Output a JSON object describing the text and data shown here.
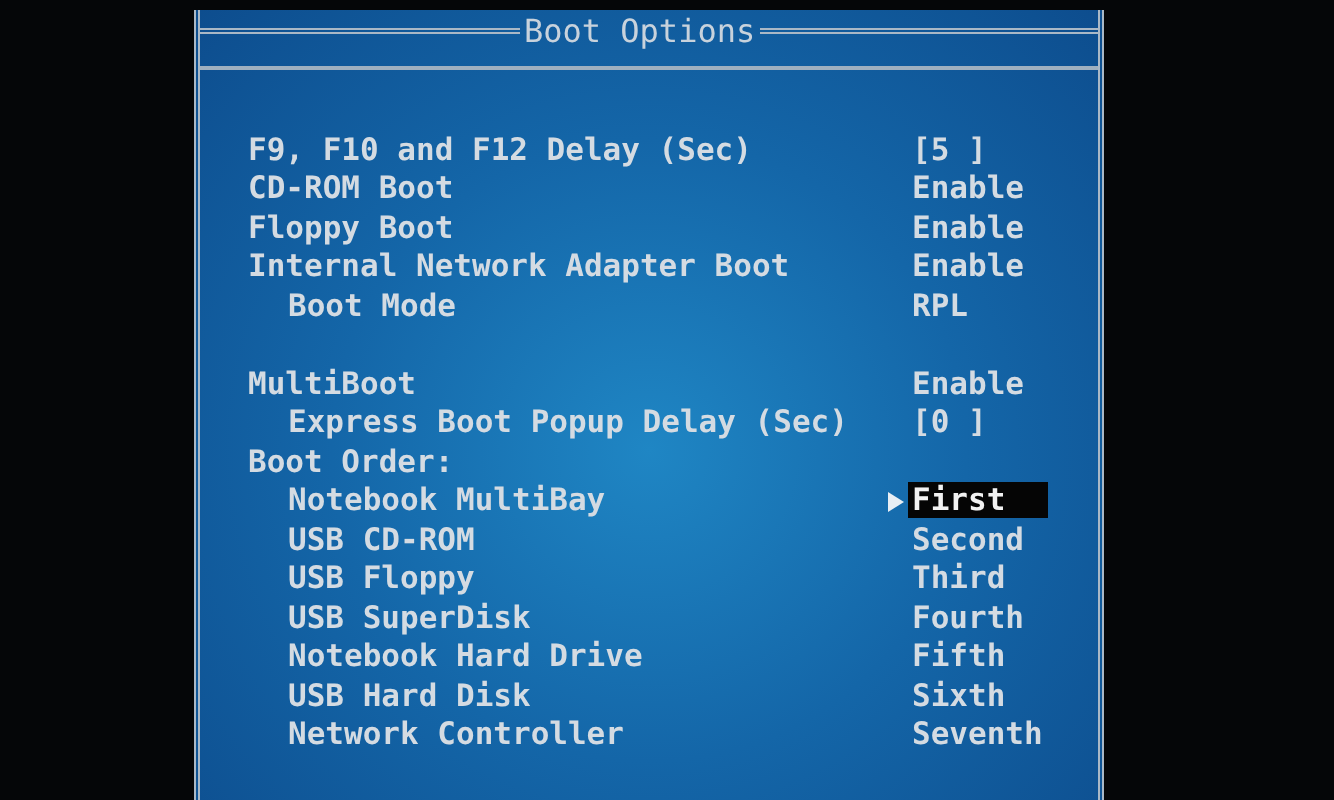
{
  "window": {
    "title": "Boot Options"
  },
  "groups": [
    {
      "items": [
        {
          "label": "F9, F10 and F12 Delay (Sec)",
          "value": "[5 ]"
        },
        {
          "label": "CD-ROM Boot",
          "value": "Enable"
        },
        {
          "label": "Floppy Boot",
          "value": "Enable"
        },
        {
          "label": "Internal Network Adapter Boot",
          "value": "Enable",
          "children": [
            {
              "label": "Boot Mode",
              "value": "RPL"
            }
          ]
        }
      ]
    },
    {
      "items": [
        {
          "label": "MultiBoot",
          "value": "Enable",
          "children": [
            {
              "label": "Express Boot Popup Delay (Sec)",
              "value": "[0 ]"
            }
          ]
        },
        {
          "label": "Boot Order:",
          "children": [
            {
              "label": "Notebook MultiBay",
              "value": "First",
              "selected": true
            },
            {
              "label": "USB CD-ROM",
              "value": "Second",
              "selected": false
            },
            {
              "label": "USB Floppy",
              "value": "Third",
              "selected": false
            },
            {
              "label": "USB SuperDisk",
              "value": "Fourth",
              "selected": false
            },
            {
              "label": "Notebook Hard Drive",
              "value": "Fifth",
              "selected": false
            },
            {
              "label": "USB Hard Disk",
              "value": "Sixth",
              "selected": false
            },
            {
              "label": "Network Controller",
              "value": "Seventh",
              "selected": false
            }
          ]
        }
      ]
    }
  ]
}
